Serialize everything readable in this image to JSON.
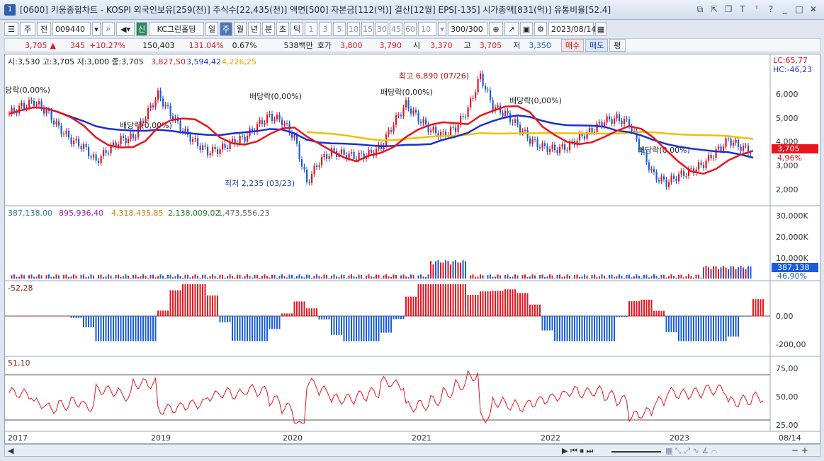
{
  "window": {
    "badge": "1",
    "title": "[0600] 키움종합차트 - KOSPI 외국인보유[259(천)] 주식수[22,435(천)] 액면[500] 자본금[112(억)] 결산[12월] EPS[-135] 시가총액[831(억)] 유통비율[52.4]"
  },
  "toolbar": {
    "period_short": "주",
    "prev": "전",
    "code": "009440",
    "badge_sin": "신",
    "stock_name": "KC그린홀딩",
    "periods": [
      "일",
      "주",
      "월",
      "년",
      "분",
      "초",
      "틱"
    ],
    "active_period": "주",
    "intervals": [
      "1",
      "3",
      "5",
      "10",
      "15",
      "30",
      "45",
      "60"
    ],
    "interval_value": "10",
    "count": "300/300",
    "date": "2023/08/14"
  },
  "quote": {
    "price": "3,705",
    "change": "345",
    "change_pct": "+10.27%",
    "volume": "150,403",
    "vol_ratio": "131.04%",
    "turnover": "0.67%",
    "amount": "538백만",
    "hoga_label": "호가",
    "ask": "3,800",
    "bid": "3,790",
    "open_label": "시",
    "open": "3,370",
    "high_label": "고",
    "high": "3,705",
    "low_label": "저",
    "low": "3,350",
    "buy": "매수",
    "sell": "매도",
    "eval": "평"
  },
  "price_panel": {
    "ohlc": "시:3,530 고:3,705 저:3,000 종:3,705",
    "ma1": "3,827,50",
    "ma2": "3,594,42",
    "ma3": "4,226,25",
    "lc": "LC:65,77",
    "hc": "HC:-46,23",
    "last_label": "3,705",
    "last_pct": "4,96%",
    "high_note": "최고 6,890 (07/26)",
    "low_note": "최저 2,235 (03/23)",
    "dividend_note": "배당락(0,00%)",
    "y_ticks": [
      "6,000",
      "5,000",
      "4,000",
      "3,000",
      "2,000"
    ],
    "colors": {
      "up": "#e8141e",
      "down": "#1a5cdc",
      "ma_red": "#e8141e",
      "ma_blue": "#1a2fd4",
      "ma_yellow": "#f0c000"
    }
  },
  "volume_panel": {
    "values": [
      "387,138,00",
      "895,936,40",
      "4,318,435,85",
      "2,138,009,02",
      "1,473,556,23"
    ],
    "y_ticks": [
      "30,000K",
      "20,000K",
      "10,000K"
    ],
    "last_label": "387,138",
    "last_pct": "46,90%"
  },
  "macd_panel": {
    "value": "-52,28",
    "y_ticks": [
      "0,00",
      "-200,00"
    ]
  },
  "rsi_panel": {
    "value": "51,10",
    "y_ticks": [
      "75,00",
      "50,00",
      "25,00"
    ]
  },
  "x_axis": {
    "labels": [
      "2017",
      "2019",
      "2020",
      "2021",
      "2022",
      "2023"
    ],
    "right_label": "08/14"
  },
  "chart_data": {
    "type": "bar",
    "series": [
      {
        "name": "weekly_close",
        "approx": true,
        "values": [
          5300,
          5600,
          5800,
          5400,
          4700,
          4200,
          3900,
          3300,
          3800,
          4200,
          4300,
          5200,
          6100,
          5300,
          4600,
          4100,
          3700,
          3800,
          4100,
          4300,
          4800,
          5200,
          5000,
          4300,
          2400,
          3300,
          3700,
          3600,
          3500,
          3600,
          3900,
          4900,
          5700,
          5100,
          4600,
          4400,
          4700,
          5500,
          6890,
          5600,
          5300,
          4800,
          4200,
          3900,
          3800,
          3900,
          4300,
          4600,
          5000,
          5100,
          4900,
          3700,
          2700,
          2400,
          2700,
          2900,
          3200,
          3700,
          4200,
          3900,
          3705
        ]
      }
    ]
  }
}
